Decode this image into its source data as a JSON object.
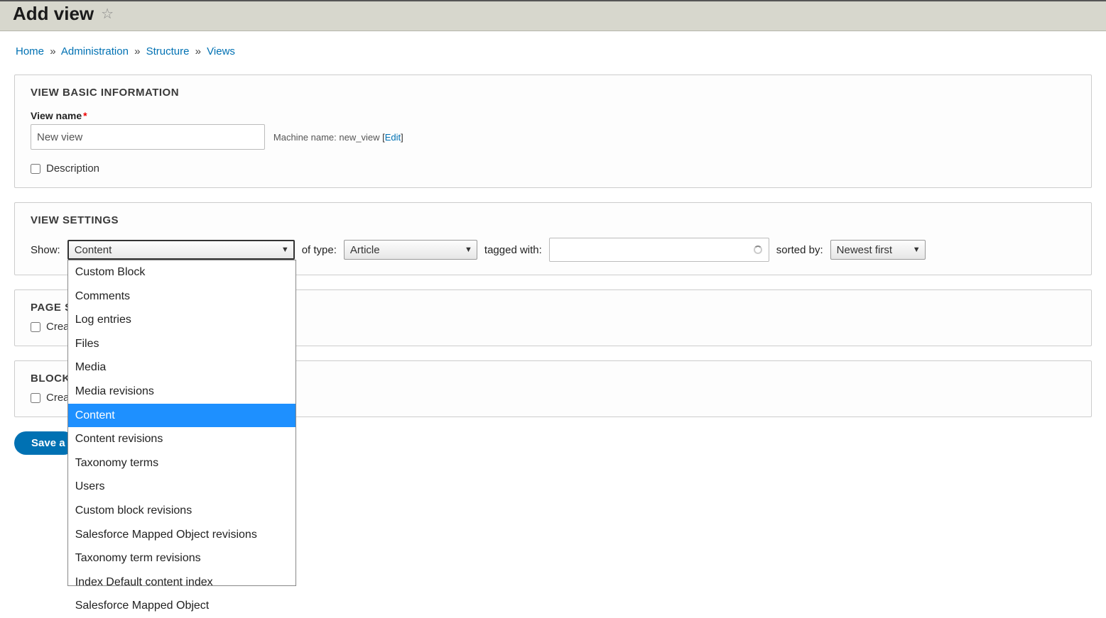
{
  "header": {
    "title": "Add view"
  },
  "breadcrumb": {
    "items": [
      "Home",
      "Administration",
      "Structure",
      "Views"
    ]
  },
  "basic": {
    "section_title": "VIEW BASIC INFORMATION",
    "view_name_label": "View name",
    "view_name_value": "New view",
    "machine_name_label": "Machine name:",
    "machine_name_value": "new_view",
    "edit_label": "Edit",
    "description_label": "Description"
  },
  "settings": {
    "section_title": "VIEW SETTINGS",
    "show_label": "Show:",
    "show_value": "Content",
    "of_type_label": "of type:",
    "of_type_value": "Article",
    "tagged_with_label": "tagged with:",
    "tagged_with_value": "",
    "sorted_by_label": "sorted by:",
    "sorted_by_value": "Newest first",
    "show_options": [
      "Custom Block",
      "Comments",
      "Log entries",
      "Files",
      "Media",
      "Media revisions",
      "Content",
      "Content revisions",
      "Taxonomy terms",
      "Users",
      "Custom block revisions",
      "Salesforce Mapped Object revisions",
      "Taxonomy term revisions",
      "Index Default content index",
      "Salesforce Mapped Object"
    ],
    "selected_option": "Content"
  },
  "page_section": {
    "title": "PAGE S",
    "create_label": "Creat"
  },
  "block_section": {
    "title": "BLOCK",
    "create_label": "Creat"
  },
  "actions": {
    "save_label": "Save a"
  }
}
